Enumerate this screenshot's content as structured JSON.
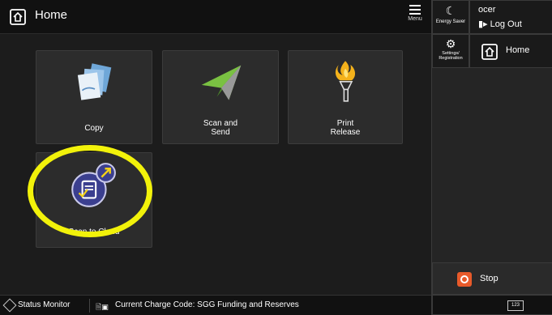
{
  "header": {
    "title": "Home",
    "menu_label": "Menu"
  },
  "right_panel": {
    "energy_saver": "Energy Saver",
    "user_name": "ocer",
    "logout": "Log Out",
    "settings_label_line1": "Settings/",
    "settings_label_line2": "Registration",
    "home": "Home",
    "stop": "Stop",
    "keypad": "123"
  },
  "tiles": [
    {
      "line1": "Copy",
      "line2": ""
    },
    {
      "line1": "Scan and",
      "line2": "Send"
    },
    {
      "line1": "Print",
      "line2": "Release"
    },
    {
      "line1": "Scan to Cloud",
      "line2": ""
    }
  ],
  "status_bar": {
    "status_monitor": "Status Monitor",
    "charge_code": "Current Charge Code: SGG Funding and Reserves"
  },
  "colors": {
    "highlight": "#f2f20a",
    "stop": "#e85a2a",
    "scan_send": "#7ac142",
    "cloud_icon": "#3b3f8f"
  }
}
